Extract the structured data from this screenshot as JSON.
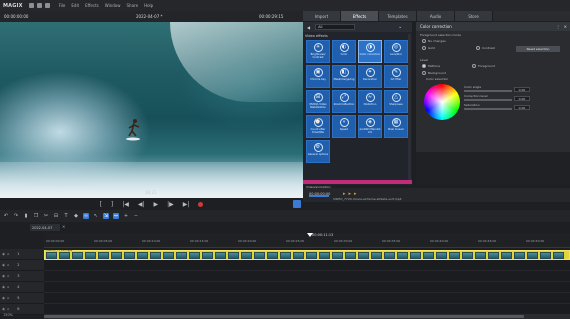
{
  "app": {
    "logo": "MAGIX",
    "menu": [
      "File",
      "Edit",
      "Effects",
      "Window",
      "Share",
      "Help"
    ]
  },
  "preview": {
    "timecode_left": "00:00:00:00",
    "date": "2022-04-07 *",
    "timecode_right": "00:00:29:15",
    "time_label": "18:21",
    "transport": [
      "[",
      "]",
      "|◀",
      "◀|",
      "▶",
      "|▶",
      "▶|"
    ]
  },
  "tabs": [
    {
      "label": "Import",
      "active": false
    },
    {
      "label": "Effects",
      "active": true
    },
    {
      "label": "Templates",
      "active": false
    },
    {
      "label": "Audio",
      "active": false
    },
    {
      "label": "Store",
      "active": false
    }
  ],
  "effects": {
    "dropdown_value": "All",
    "section_label": "Video effects",
    "items": [
      {
        "label": "Brightness/ Contrast",
        "glyph": "☀"
      },
      {
        "label": "Color",
        "glyph": "◐"
      },
      {
        "label": "Color correction",
        "glyph": "◑",
        "selected": true
      },
      {
        "label": "Lens/blur",
        "glyph": "◎"
      },
      {
        "label": "Chroma key",
        "glyph": "▣"
      },
      {
        "label": "Mask/merge/ing",
        "glyph": "◧"
      },
      {
        "label": "Decoration",
        "glyph": "✦"
      },
      {
        "label": "Art filter",
        "glyph": "✎"
      },
      {
        "label": "NVIDIA Video Stabilization",
        "glyph": "⊞"
      },
      {
        "label": "Zoom/reflection",
        "glyph": "⤢"
      },
      {
        "label": "Distortion",
        "glyph": "≈"
      },
      {
        "label": "Sharpness",
        "glyph": "△"
      },
      {
        "label": "Count after time/title",
        "glyph": "⌚"
      },
      {
        "label": "Speed",
        "glyph": "»"
      },
      {
        "label": "proDAD Mercalli 2.0",
        "glyph": "◈"
      },
      {
        "label": "Pixel mosaic",
        "glyph": "▦"
      },
      {
        "label": "General options",
        "glyph": "⚙"
      }
    ],
    "footer_label": "Video/animation"
  },
  "color_correction": {
    "title": "Color correction",
    "section1": "Foreground selection mode",
    "options1": [
      "No changes",
      "Gold",
      "Contrast"
    ],
    "reset_label": "Reset selection",
    "section2": "Level",
    "options2": [
      "Midtone",
      "Foreground",
      "Background"
    ],
    "color_selection": "Color selection",
    "sliders": [
      {
        "label": "Color angle",
        "value": "0.00"
      },
      {
        "label": "Correction level",
        "value": "0.00"
      },
      {
        "label": "Saturation",
        "value": "0.00"
      }
    ]
  },
  "status": {
    "counter": "00:00:00:00",
    "filename": "VIDEO_7729-movie-extreme-athlete-surf.mp4"
  },
  "timeline": {
    "name": "2022-04-07",
    "playhead_tc": "00:00:11:13",
    "ticks": [
      "00:00:00:00",
      "00:00:05:00",
      "00:00:10:00",
      "00:00:15:00",
      "00:00:20:00",
      "00:00:25:00",
      "00:00:30:00",
      "00:00:35:00",
      "00:00:40:00",
      "00:00:45:00",
      "00:00:50:00"
    ],
    "clip_title": "VIDEO_7729.mp4",
    "tracks": [
      "1",
      "2",
      "3",
      "4",
      "5",
      "6"
    ],
    "zoom": "150%"
  },
  "colors": {
    "accent_blue": "#1f5fae",
    "clip_yellow": "#e2d43a",
    "record_red": "#d23a3a"
  }
}
